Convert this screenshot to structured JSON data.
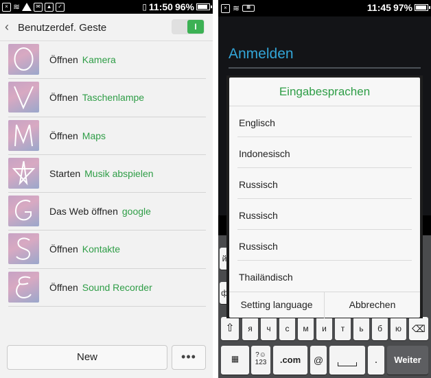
{
  "left": {
    "status": {
      "time": "11:50",
      "battery": "96%",
      "battery_fill": 0.96
    },
    "header": {
      "title": "Benutzerdef. Geste",
      "toggle_on": true,
      "toggle_glyph": "I"
    },
    "gestures": [
      {
        "letter": "O",
        "action": "Öffnen",
        "target": "Kamera"
      },
      {
        "letter": "V",
        "action": "Öffnen",
        "target": "Taschenlampe"
      },
      {
        "letter": "M",
        "action": "Öffnen",
        "target": "Maps"
      },
      {
        "letter": "star",
        "action": "Starten",
        "target": "Musik abspielen"
      },
      {
        "letter": "G",
        "action": "Das Web öffnen",
        "target": "google"
      },
      {
        "letter": "S",
        "action": "Öffnen",
        "target": "Kontakte"
      },
      {
        "letter": "E",
        "action": "Öffnen",
        "target": "Sound Recorder"
      }
    ],
    "bottom": {
      "new_label": "New",
      "more_label": "•••"
    }
  },
  "right": {
    "status": {
      "time": "11:45",
      "battery": "97%",
      "battery_fill": 0.97
    },
    "login_title": "Anmelden",
    "dialog": {
      "title": "Eingabesprachen",
      "languages": [
        "Englisch",
        "Indonesisch",
        "Russisch",
        "Russisch",
        "Russisch",
        "Thailändisch"
      ],
      "setting_label": "Setting language",
      "cancel_label": "Abbrechen"
    },
    "keyboard": {
      "row1_visible": [
        "й",
        "ф"
      ],
      "row3": [
        "я",
        "ч",
        "с",
        "м",
        "и",
        "т",
        "ь",
        "б",
        "ю"
      ],
      "shift": "⇧",
      "backspace": "⌫",
      "symbols_top": "?☺",
      "symbols_bottom": "123",
      "com": ".com",
      "at": "@",
      "period": ".",
      "enter": "Weiter"
    }
  }
}
